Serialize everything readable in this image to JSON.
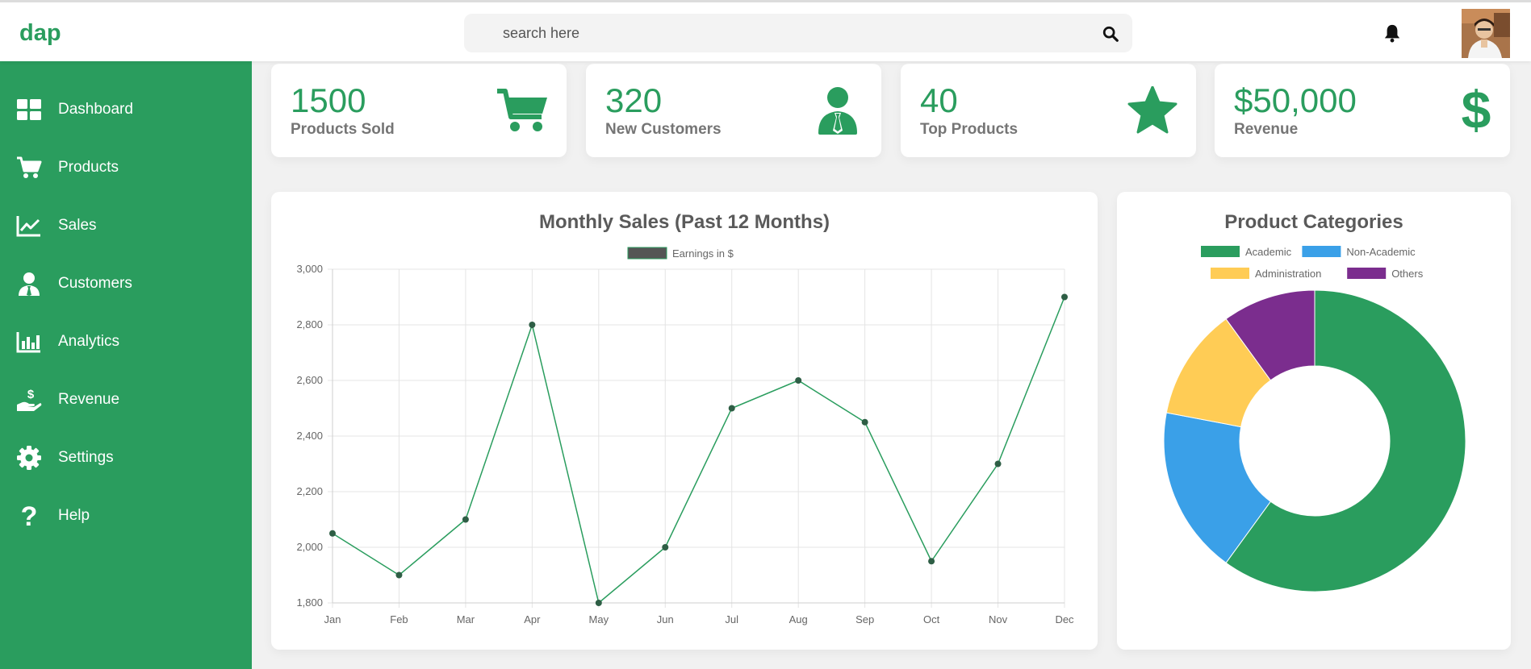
{
  "app": {
    "logo": "dap"
  },
  "search": {
    "placeholder": "search here",
    "value": ""
  },
  "header": {
    "notification_icon": "bell-icon",
    "avatar_icon": "user-avatar"
  },
  "sidebar": {
    "items": [
      {
        "label": "Dashboard",
        "icon": "dashboard-icon"
      },
      {
        "label": "Products",
        "icon": "cart-icon"
      },
      {
        "label": "Sales",
        "icon": "chart-line-icon"
      },
      {
        "label": "Customers",
        "icon": "user-tie-icon"
      },
      {
        "label": "Analytics",
        "icon": "chart-bar-icon"
      },
      {
        "label": "Revenue",
        "icon": "hand-dollar-icon"
      },
      {
        "label": "Settings",
        "icon": "gear-icon"
      },
      {
        "label": "Help",
        "icon": "question-icon"
      }
    ]
  },
  "cards": [
    {
      "value": "1500",
      "label": "Products Sold",
      "icon": "cart-icon"
    },
    {
      "value": "320",
      "label": "New Customers",
      "icon": "user-tie-icon"
    },
    {
      "value": "40",
      "label": "Top Products",
      "icon": "star-icon"
    },
    {
      "value": "$50,000",
      "label": "Revenue",
      "icon": "dollar-icon"
    }
  ],
  "colors": {
    "brand": "#2a9d5e",
    "line": "#2a9d5e",
    "point": "#2e5e45",
    "legend_box": "#555555"
  },
  "chart_data": [
    {
      "type": "line",
      "title": "Monthly Sales (Past 12 Months)",
      "categories": [
        "Jan",
        "Feb",
        "Mar",
        "Apr",
        "May",
        "Jun",
        "Jul",
        "Aug",
        "Sep",
        "Oct",
        "Nov",
        "Dec"
      ],
      "series": [
        {
          "name": "Earnings in $",
          "values": [
            2050,
            1900,
            2100,
            2800,
            1800,
            2000,
            2500,
            2600,
            2450,
            1950,
            2300,
            2900
          ]
        }
      ],
      "ylim": [
        1800,
        3000
      ],
      "yticks": [
        1800,
        2000,
        2200,
        2400,
        2600,
        2800,
        3000
      ],
      "grid": true,
      "legend": "top-center"
    },
    {
      "type": "pie",
      "title": "Product Categories",
      "labels": [
        "Academic",
        "Non-Academic",
        "Administration",
        "Others"
      ],
      "values": [
        60,
        18,
        12,
        10
      ],
      "colors": [
        "#2a9d5e",
        "#3aa0e8",
        "#ffcc55",
        "#7b2d8e"
      ],
      "legend": "top-center",
      "donut": true
    }
  ]
}
